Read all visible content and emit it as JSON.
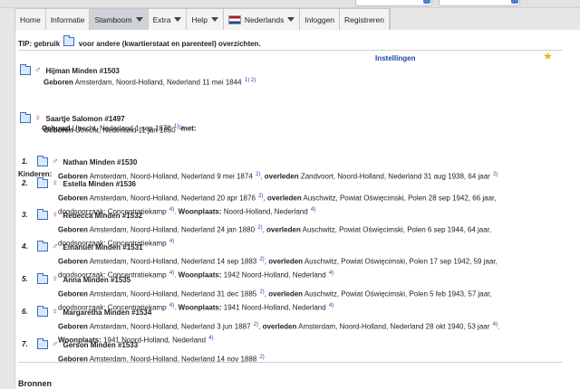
{
  "nav": {
    "items": [
      {
        "label": "Home",
        "dropdown": false,
        "active": false
      },
      {
        "label": "Informatie",
        "dropdown": false,
        "active": false
      },
      {
        "label": "Stamboom",
        "dropdown": true,
        "active": true
      },
      {
        "label": "Extra",
        "dropdown": true,
        "active": false
      },
      {
        "label": "Help",
        "dropdown": true,
        "active": false
      },
      {
        "label": "Nederlands",
        "dropdown": true,
        "active": false,
        "flag": true
      },
      {
        "label": "Inloggen",
        "dropdown": false,
        "active": false
      },
      {
        "label": "Registreren",
        "dropdown": false,
        "active": false
      }
    ]
  },
  "tip": {
    "prefix": "TIP: gebruik",
    "suffix": "voor andere (kwartierstaat en parenteel) overzichten."
  },
  "settings_label": "Instellingen",
  "father": {
    "name": "Hijman Minden #1503",
    "gender": "male",
    "line_label": "Geboren",
    "line_text": "Amsterdam, Noord-Holland, Nederland 11 mei 1844",
    "sources": "1) 2)"
  },
  "marriage": {
    "label": "Gehuwd",
    "text": "Utrecht, Nederland 1 sep 1870",
    "sources": "1)",
    "suffix": "met:"
  },
  "mother": {
    "name": "Saartje Salomon #1497",
    "gender": "female",
    "line_label": "Geboren",
    "line_text": "Utrecht, Nederland 11 jan 1850",
    "sources": "1)"
  },
  "children_heading": "Kinderen:",
  "children": [
    {
      "num": "1.",
      "name": "Nathan Minden #1530",
      "gender": "male",
      "parts": [
        {
          "b": "Geboren"
        },
        {
          "t": " Amsterdam, Noord-Holland, Nederland 9 mei 1874 "
        },
        {
          "s": "2)"
        },
        {
          "t": ", "
        },
        {
          "b": "overleden"
        },
        {
          "t": " Zandvoort, Noord-Holland, Nederland 31 aug 1938, 64 jaar "
        },
        {
          "s": "2)"
        }
      ]
    },
    {
      "num": "2.",
      "name": "Estella Minden #1536",
      "gender": "female",
      "parts": [
        {
          "b": "Geboren"
        },
        {
          "t": " Amsterdam, Noord-Holland, Nederland 20 apr 1876 "
        },
        {
          "s": "2)"
        },
        {
          "t": ", "
        },
        {
          "b": "overleden"
        },
        {
          "t": " Auschwitz, Powiat Oświęcimski, Polen 28 sep 1942, 66 jaar, doodsoorzaak: Concentratiekamp "
        },
        {
          "s": "4)"
        },
        {
          "t": ". "
        },
        {
          "b": "Woonplaats:"
        },
        {
          "t": " Noord-Holland, Nederland "
        },
        {
          "s": "4)"
        }
      ]
    },
    {
      "num": "3.",
      "name": "Rebecca Minden #1532",
      "gender": "female",
      "parts": [
        {
          "b": "Geboren"
        },
        {
          "t": " Amsterdam, Noord-Holland, Nederland 24 jan 1880 "
        },
        {
          "s": "2)"
        },
        {
          "t": ", "
        },
        {
          "b": "overleden"
        },
        {
          "t": " Auschwitz, Powiat Oświęcimski, Polen 6 sep 1944, 64 jaar, doodsoorzaak: Concentratiekamp "
        },
        {
          "s": "4)"
        }
      ]
    },
    {
      "num": "4.",
      "name": "Emanuël Minden #1531",
      "gender": "male",
      "parts": [
        {
          "b": "Geboren"
        },
        {
          "t": " Amsterdam, Noord-Holland, Nederland 14 sep 1883 "
        },
        {
          "s": "2)"
        },
        {
          "t": ", "
        },
        {
          "b": "overleden"
        },
        {
          "t": " Auschwitz, Powiat Oświęcimski, Polen 17 sep 1942, 59 jaar, doodsoorzaak: Concentratiekamp "
        },
        {
          "s": "4)"
        },
        {
          "t": ". "
        },
        {
          "b": "Woonplaats:"
        },
        {
          "t": " 1942 Noord-Holland, Nederland "
        },
        {
          "s": "4)"
        }
      ]
    },
    {
      "num": "5.",
      "name": "Anna Minden #1535",
      "gender": "female",
      "parts": [
        {
          "b": "Geboren"
        },
        {
          "t": " Amsterdam, Noord-Holland, Nederland 31 dec 1885 "
        },
        {
          "s": "2)"
        },
        {
          "t": ", "
        },
        {
          "b": "overleden"
        },
        {
          "t": " Auschwitz, Powiat Oświęcimski, Polen 5 feb 1943, 57 jaar, doodsoorzaak: Concentratiekamp "
        },
        {
          "s": "4)"
        },
        {
          "t": ". "
        },
        {
          "b": "Woonplaats:"
        },
        {
          "t": " 1941 Noord-Holland, Nederland "
        },
        {
          "s": "4)"
        }
      ]
    },
    {
      "num": "6.",
      "name": "Margaretha Minden #1534",
      "gender": "female",
      "parts": [
        {
          "b": "Geboren"
        },
        {
          "t": " Amsterdam, Noord-Holland, Nederland 3 jun 1887 "
        },
        {
          "s": "2)"
        },
        {
          "t": ", "
        },
        {
          "b": "overleden"
        },
        {
          "t": " Amsterdam, Noord-Holland, Nederland 28 okt 1940, 53 jaar "
        },
        {
          "s": "4)"
        },
        {
          "t": ". "
        },
        {
          "b": "Woonplaats:"
        },
        {
          "t": " 1941 Noord-Holland, Nederland "
        },
        {
          "s": "4)"
        }
      ]
    },
    {
      "num": "7.",
      "name": "Gerson Minden #1533",
      "gender": "male",
      "parts": [
        {
          "b": "Geboren"
        },
        {
          "t": " Amsterdam, Noord-Holland, Nederland 14 nov 1888 "
        },
        {
          "s": "2)"
        }
      ]
    }
  ],
  "bronnen_heading": "Bronnen"
}
